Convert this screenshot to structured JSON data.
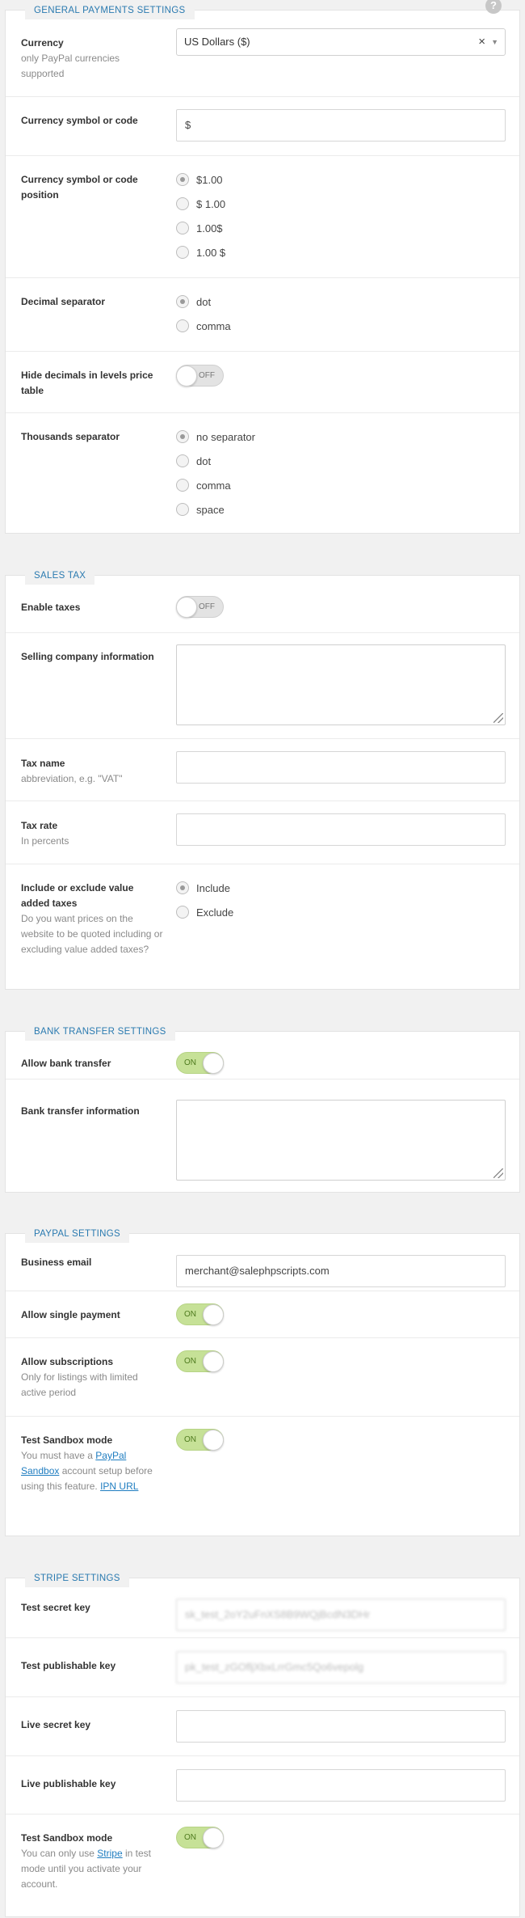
{
  "general": {
    "title": "GENERAL PAYMENTS SETTINGS",
    "help_icon": "?",
    "currency": {
      "label": "Currency",
      "desc": "only PayPal currencies supported",
      "value": "US Dollars ($)",
      "clear": "×",
      "arrow": "▼"
    },
    "symbol": {
      "label": "Currency symbol or code",
      "value": "$"
    },
    "position": {
      "label": "Currency symbol or code position",
      "options": [
        "$1.00",
        "$ 1.00",
        "1.00$",
        "1.00 $"
      ],
      "selected": 0
    },
    "decimal": {
      "label": "Decimal separator",
      "options": [
        "dot",
        "comma"
      ],
      "selected": 0
    },
    "hide_decimals": {
      "label": "Hide decimals in levels price table",
      "state": "OFF"
    },
    "thousands": {
      "label": "Thousands separator",
      "options": [
        "no separator",
        "dot",
        "comma",
        "space"
      ],
      "selected": 0
    }
  },
  "sales_tax": {
    "title": "SALES TAX",
    "enable": {
      "label": "Enable taxes",
      "state": "OFF"
    },
    "company": {
      "label": "Selling company information",
      "value": ""
    },
    "tax_name": {
      "label": "Tax name",
      "desc": "abbreviation, e.g. \"VAT\"",
      "value": ""
    },
    "tax_rate": {
      "label": "Tax rate",
      "desc": "In percents",
      "value": ""
    },
    "include": {
      "label": "Include or exclude value added taxes",
      "desc": "Do you want prices on the website to be quoted including or excluding value added taxes?",
      "options": [
        "Include",
        "Exclude"
      ],
      "selected": 0
    }
  },
  "bank": {
    "title": "BANK TRANSFER SETTINGS",
    "allow": {
      "label": "Allow bank transfer",
      "state": "ON"
    },
    "info": {
      "label": "Bank transfer information",
      "value": ""
    }
  },
  "paypal": {
    "title": "PAYPAL SETTINGS",
    "email": {
      "label": "Business email",
      "value": "merchant@salephpscripts.com"
    },
    "single": {
      "label": "Allow single payment",
      "state": "ON"
    },
    "subscriptions": {
      "label": "Allow subscriptions",
      "desc": "Only for listings with limited active period",
      "state": "ON"
    },
    "sandbox": {
      "label": "Test Sandbox mode",
      "desc_1": "You must have a ",
      "link_1": "PayPal Sandbox",
      "desc_2": " account setup before using this feature. ",
      "link_2": "IPN URL",
      "state": "ON"
    }
  },
  "stripe": {
    "title": "STRIPE SETTINGS",
    "test_secret": {
      "label": "Test secret key",
      "value": "sk_test_2oY2uFnXS8B9WQjBcdN3DHr"
    },
    "test_publishable": {
      "label": "Test publishable key",
      "value": "pk_test_zGOfljXbxLrrGmc5Qo6vepolg"
    },
    "live_secret": {
      "label": "Live secret key",
      "value": ""
    },
    "live_publishable": {
      "label": "Live publishable key",
      "value": ""
    },
    "sandbox": {
      "label": "Test Sandbox mode",
      "desc_1": "You can only use ",
      "link": "Stripe",
      "desc_2": " in test mode until you activate your account.",
      "state": "ON"
    }
  }
}
